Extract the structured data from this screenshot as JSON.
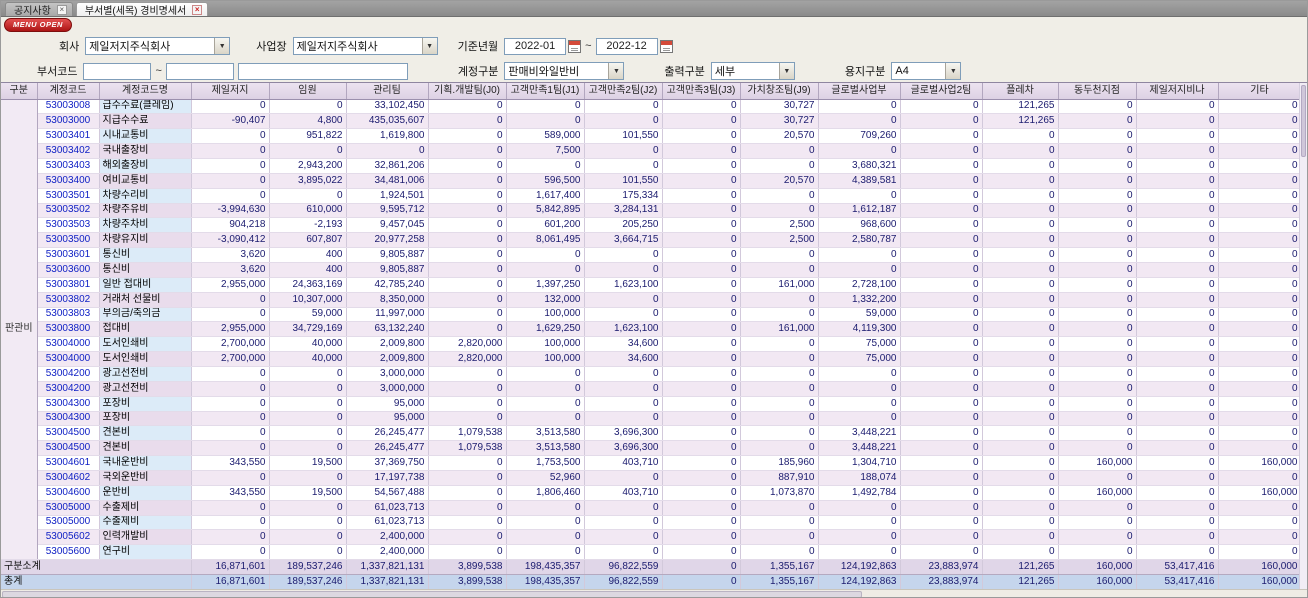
{
  "tabs": [
    {
      "label": "공지사항"
    },
    {
      "label": "부서별(세목) 경비명세서"
    }
  ],
  "tab_close": "×",
  "menu_open_label": "MENU OPEN",
  "filters": {
    "company_label": "회사",
    "company_value": "제일저지주식회사",
    "workplace_label": "사업장",
    "workplace_value": "제일저지주식회사",
    "period_label": "기준년월",
    "period_from": "2022-01",
    "period_to": "2022-12",
    "range_separator": "~",
    "dept_label": "부서코드",
    "dept_from": "",
    "dept_to": "",
    "dept_name": "",
    "account_label": "계정구분",
    "account_value": "판매비와일반비",
    "output_label": "출력구분",
    "output_value": "세부",
    "paper_label": "용지구분",
    "paper_value": "A4",
    "dropdown_arrow": "▼"
  },
  "table": {
    "group_label": "판관비",
    "columns": [
      "구분",
      "계정코드",
      "계정코드명",
      "제일저지",
      "임원",
      "관리팀",
      "기획.개발팀(J0)",
      "고객만족1팀(J1)",
      "고객만족2팀(J2)",
      "고객만족3팀(J3)",
      "가치창조팀(J9)",
      "글로벌사업부",
      "글로벌사업2팀",
      "플레차",
      "동두천지점",
      "제일저지비나",
      "기타"
    ],
    "rows": [
      {
        "code": "53003008",
        "name": "급수수료(클레임)",
        "values": [
          "0",
          "0",
          "33,102,450",
          "0",
          "0",
          "0",
          "0",
          "30,727",
          "0",
          "0",
          "121,265",
          "0",
          "0",
          "0"
        ]
      },
      {
        "code": "53003000",
        "name": "지급수수료",
        "values": [
          "-90,407",
          "4,800",
          "435,035,607",
          "0",
          "0",
          "0",
          "0",
          "30,727",
          "0",
          "0",
          "121,265",
          "0",
          "0",
          "0"
        ]
      },
      {
        "code": "53003401",
        "name": "시내교통비",
        "values": [
          "0",
          "951,822",
          "1,619,800",
          "0",
          "589,000",
          "101,550",
          "0",
          "20,570",
          "709,260",
          "0",
          "0",
          "0",
          "0",
          "0"
        ]
      },
      {
        "code": "53003402",
        "name": "국내출장비",
        "values": [
          "0",
          "0",
          "0",
          "0",
          "7,500",
          "0",
          "0",
          "0",
          "0",
          "0",
          "0",
          "0",
          "0",
          "0"
        ]
      },
      {
        "code": "53003403",
        "name": "해외출장비",
        "values": [
          "0",
          "2,943,200",
          "32,861,206",
          "0",
          "0",
          "0",
          "0",
          "0",
          "3,680,321",
          "0",
          "0",
          "0",
          "0",
          "0"
        ]
      },
      {
        "code": "53003400",
        "name": "여비교통비",
        "values": [
          "0",
          "3,895,022",
          "34,481,006",
          "0",
          "596,500",
          "101,550",
          "0",
          "20,570",
          "4,389,581",
          "0",
          "0",
          "0",
          "0",
          "0"
        ]
      },
      {
        "code": "53003501",
        "name": "차량수리비",
        "values": [
          "0",
          "0",
          "1,924,501",
          "0",
          "1,617,400",
          "175,334",
          "0",
          "0",
          "0",
          "0",
          "0",
          "0",
          "0",
          "0"
        ]
      },
      {
        "code": "53003502",
        "name": "차량주유비",
        "values": [
          "-3,994,630",
          "610,000",
          "9,595,712",
          "0",
          "5,842,895",
          "3,284,131",
          "0",
          "0",
          "1,612,187",
          "0",
          "0",
          "0",
          "0",
          "0"
        ]
      },
      {
        "code": "53003503",
        "name": "차량주차비",
        "values": [
          "904,218",
          "-2,193",
          "9,457,045",
          "0",
          "601,200",
          "205,250",
          "0",
          "2,500",
          "968,600",
          "0",
          "0",
          "0",
          "0",
          "0"
        ]
      },
      {
        "code": "53003500",
        "name": "차량유지비",
        "values": [
          "-3,090,412",
          "607,807",
          "20,977,258",
          "0",
          "8,061,495",
          "3,664,715",
          "0",
          "2,500",
          "2,580,787",
          "0",
          "0",
          "0",
          "0",
          "0"
        ]
      },
      {
        "code": "53003601",
        "name": "통신비",
        "values": [
          "3,620",
          "400",
          "9,805,887",
          "0",
          "0",
          "0",
          "0",
          "0",
          "0",
          "0",
          "0",
          "0",
          "0",
          "0"
        ]
      },
      {
        "code": "53003600",
        "name": "통신비",
        "values": [
          "3,620",
          "400",
          "9,805,887",
          "0",
          "0",
          "0",
          "0",
          "0",
          "0",
          "0",
          "0",
          "0",
          "0",
          "0"
        ]
      },
      {
        "code": "53003801",
        "name": "일반 접대비",
        "values": [
          "2,955,000",
          "24,363,169",
          "42,785,240",
          "0",
          "1,397,250",
          "1,623,100",
          "0",
          "161,000",
          "2,728,100",
          "0",
          "0",
          "0",
          "0",
          "0"
        ]
      },
      {
        "code": "53003802",
        "name": "거래처 선물비",
        "values": [
          "0",
          "10,307,000",
          "8,350,000",
          "0",
          "132,000",
          "0",
          "0",
          "0",
          "1,332,200",
          "0",
          "0",
          "0",
          "0",
          "0"
        ]
      },
      {
        "code": "53003803",
        "name": "부의금/축의금",
        "values": [
          "0",
          "59,000",
          "11,997,000",
          "0",
          "100,000",
          "0",
          "0",
          "0",
          "59,000",
          "0",
          "0",
          "0",
          "0",
          "0"
        ]
      },
      {
        "code": "53003800",
        "name": "접대비",
        "values": [
          "2,955,000",
          "34,729,169",
          "63,132,240",
          "0",
          "1,629,250",
          "1,623,100",
          "0",
          "161,000",
          "4,119,300",
          "0",
          "0",
          "0",
          "0",
          "0"
        ]
      },
      {
        "code": "53004000",
        "name": "도서인쇄비",
        "values": [
          "2,700,000",
          "40,000",
          "2,009,800",
          "2,820,000",
          "100,000",
          "34,600",
          "0",
          "0",
          "75,000",
          "0",
          "0",
          "0",
          "0",
          "0"
        ]
      },
      {
        "code": "53004000",
        "name": "도서인쇄비",
        "values": [
          "2,700,000",
          "40,000",
          "2,009,800",
          "2,820,000",
          "100,000",
          "34,600",
          "0",
          "0",
          "75,000",
          "0",
          "0",
          "0",
          "0",
          "0"
        ]
      },
      {
        "code": "53004200",
        "name": "광고선전비",
        "values": [
          "0",
          "0",
          "3,000,000",
          "0",
          "0",
          "0",
          "0",
          "0",
          "0",
          "0",
          "0",
          "0",
          "0",
          "0"
        ]
      },
      {
        "code": "53004200",
        "name": "광고선전비",
        "values": [
          "0",
          "0",
          "3,000,000",
          "0",
          "0",
          "0",
          "0",
          "0",
          "0",
          "0",
          "0",
          "0",
          "0",
          "0"
        ]
      },
      {
        "code": "53004300",
        "name": "포장비",
        "values": [
          "0",
          "0",
          "95,000",
          "0",
          "0",
          "0",
          "0",
          "0",
          "0",
          "0",
          "0",
          "0",
          "0",
          "0"
        ]
      },
      {
        "code": "53004300",
        "name": "포장비",
        "values": [
          "0",
          "0",
          "95,000",
          "0",
          "0",
          "0",
          "0",
          "0",
          "0",
          "0",
          "0",
          "0",
          "0",
          "0"
        ]
      },
      {
        "code": "53004500",
        "name": "견본비",
        "values": [
          "0",
          "0",
          "26,245,477",
          "1,079,538",
          "3,513,580",
          "3,696,300",
          "0",
          "0",
          "3,448,221",
          "0",
          "0",
          "0",
          "0",
          "0"
        ]
      },
      {
        "code": "53004500",
        "name": "견본비",
        "values": [
          "0",
          "0",
          "26,245,477",
          "1,079,538",
          "3,513,580",
          "3,696,300",
          "0",
          "0",
          "3,448,221",
          "0",
          "0",
          "0",
          "0",
          "0"
        ]
      },
      {
        "code": "53004601",
        "name": "국내운반비",
        "values": [
          "343,550",
          "19,500",
          "37,369,750",
          "0",
          "1,753,500",
          "403,710",
          "0",
          "185,960",
          "1,304,710",
          "0",
          "0",
          "160,000",
          "0",
          "160,000"
        ]
      },
      {
        "code": "53004602",
        "name": "국외운반비",
        "values": [
          "0",
          "0",
          "17,197,738",
          "0",
          "52,960",
          "0",
          "0",
          "887,910",
          "188,074",
          "0",
          "0",
          "0",
          "0",
          "0"
        ]
      },
      {
        "code": "53004600",
        "name": "운반비",
        "values": [
          "343,550",
          "19,500",
          "54,567,488",
          "0",
          "1,806,460",
          "403,710",
          "0",
          "1,073,870",
          "1,492,784",
          "0",
          "0",
          "160,000",
          "0",
          "160,000"
        ]
      },
      {
        "code": "53005000",
        "name": "수출제비",
        "values": [
          "0",
          "0",
          "61,023,713",
          "0",
          "0",
          "0",
          "0",
          "0",
          "0",
          "0",
          "0",
          "0",
          "0",
          "0"
        ]
      },
      {
        "code": "53005000",
        "name": "수출제비",
        "values": [
          "0",
          "0",
          "61,023,713",
          "0",
          "0",
          "0",
          "0",
          "0",
          "0",
          "0",
          "0",
          "0",
          "0",
          "0"
        ]
      },
      {
        "code": "53005602",
        "name": "인력개발비",
        "values": [
          "0",
          "0",
          "2,400,000",
          "0",
          "0",
          "0",
          "0",
          "0",
          "0",
          "0",
          "0",
          "0",
          "0",
          "0"
        ]
      },
      {
        "code": "53005600",
        "name": "연구비",
        "values": [
          "0",
          "0",
          "2,400,000",
          "0",
          "0",
          "0",
          "0",
          "0",
          "0",
          "0",
          "0",
          "0",
          "0",
          "0"
        ]
      }
    ],
    "footer": [
      {
        "label": "구분소계",
        "values": [
          "16,871,601",
          "189,537,246",
          "1,337,821,131",
          "3,899,538",
          "198,435,357",
          "96,822,559",
          "0",
          "1,355,167",
          "124,192,863",
          "23,883,974",
          "121,265",
          "160,000",
          "53,417,416",
          "160,000"
        ]
      },
      {
        "label": "총계",
        "values": [
          "16,871,601",
          "189,537,246",
          "1,337,821,131",
          "3,899,538",
          "198,435,357",
          "96,822,559",
          "0",
          "1,355,167",
          "124,192,863",
          "23,883,974",
          "121,265",
          "160,000",
          "53,417,416",
          "160,000"
        ]
      }
    ]
  }
}
